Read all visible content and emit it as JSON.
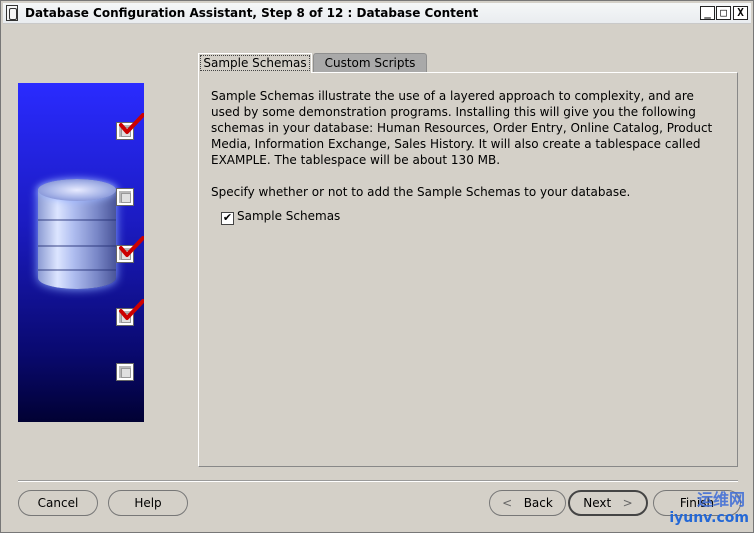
{
  "window": {
    "title": "Database Configuration Assistant, Step 8 of 12 : Database Content",
    "controls": {
      "minimize": "_",
      "maximize": "□",
      "close": "X"
    }
  },
  "steps": [
    {
      "checked": true
    },
    {
      "checked": false
    },
    {
      "checked": true
    },
    {
      "checked": true
    },
    {
      "checked": false
    }
  ],
  "tabs": [
    {
      "label": "Sample Schemas",
      "active": true
    },
    {
      "label": "Custom Scripts",
      "active": false
    }
  ],
  "panel": {
    "description": "Sample Schemas illustrate the use of a layered approach to complexity, and are used by some demonstration programs. Installing this will give you the following schemas in your database: Human Resources, Order Entry, Online Catalog, Product Media, Information Exchange, Sales History. It will also create a tablespace called EXAMPLE. The tablespace will be about 130 MB.",
    "prompt": "Specify whether or not to add the Sample Schemas to your database.",
    "checkbox": {
      "label": "Sample Schemas",
      "checked": true
    }
  },
  "buttons": {
    "cancel": "Cancel",
    "help": "Help",
    "back": "Back",
    "next": "Next",
    "finish": "Finish"
  },
  "watermark": {
    "line1": "运维网",
    "line2": "iyunv.com"
  },
  "colors": {
    "window_bg": "#d4d0c8",
    "side_image_top": "#2a2bff",
    "side_image_bottom": "#010133",
    "check_red": "#cc0000"
  }
}
